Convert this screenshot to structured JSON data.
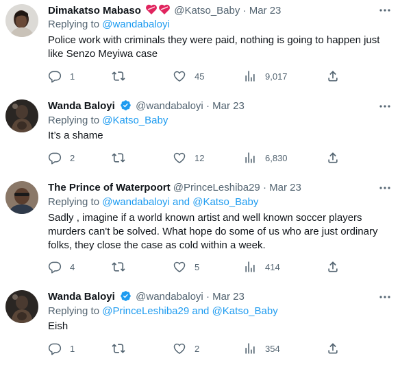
{
  "replying_prefix": "Replying to",
  "tweets": [
    {
      "name": "Dimakatso Mabaso",
      "name_emoji": "two-hearts-emoji",
      "handle": "@Katso_Baby",
      "separator": "·",
      "date": "Mar 23",
      "verified": false,
      "reply_to": "@wandabaloyi",
      "reply_and": "",
      "reply_to_2": "",
      "text": "Police work with criminals they were paid, nothing is going to happen just like Senzo Meyiwa case",
      "stats": {
        "replies": "1",
        "retweets": "",
        "likes": "45",
        "views": "9,017"
      }
    },
    {
      "name": "Wanda Baloyi",
      "handle": "@wandabaloyi",
      "separator": "·",
      "date": "Mar 23",
      "verified": true,
      "reply_to": "@Katso_Baby",
      "reply_and": "",
      "reply_to_2": "",
      "text": "It’s a shame",
      "stats": {
        "replies": "2",
        "retweets": "",
        "likes": "12",
        "views": "6,830"
      }
    },
    {
      "name": "The Prince of Waterpoort",
      "handle": "@PrinceLeshiba29",
      "separator": "·",
      "date": "Mar 23",
      "verified": false,
      "reply_to": "@wandabaloyi",
      "reply_and": "and",
      "reply_to_2": "@Katso_Baby",
      "text": "Sadly , imagine if a world known artist and well known soccer players murders can't be solved. What hope do some of us who are just ordinary folks, they close the case as cold within a week.",
      "stats": {
        "replies": "4",
        "retweets": "",
        "likes": "5",
        "views": "414"
      }
    },
    {
      "name": "Wanda Baloyi",
      "handle": "@wandabaloyi",
      "separator": "·",
      "date": "Mar 23",
      "verified": true,
      "reply_to": "@PrinceLeshiba29",
      "reply_and": "and",
      "reply_to_2": "@Katso_Baby",
      "text": "Eish",
      "stats": {
        "replies": "1",
        "retweets": "",
        "likes": "2",
        "views": "354"
      }
    }
  ],
  "icons": {
    "more": "more-horizontal-icon",
    "reply": "reply-bubble-icon",
    "retweet": "retweet-icon",
    "like": "heart-icon",
    "views": "views-bar-chart-icon",
    "share": "share-icon",
    "verified": "verified-badge-icon"
  },
  "colors": {
    "text": "#0f1419",
    "secondary": "#536471",
    "link": "#1d9bf0",
    "verified": "#1d9bf0",
    "heart_emoji": "#e0245e"
  }
}
